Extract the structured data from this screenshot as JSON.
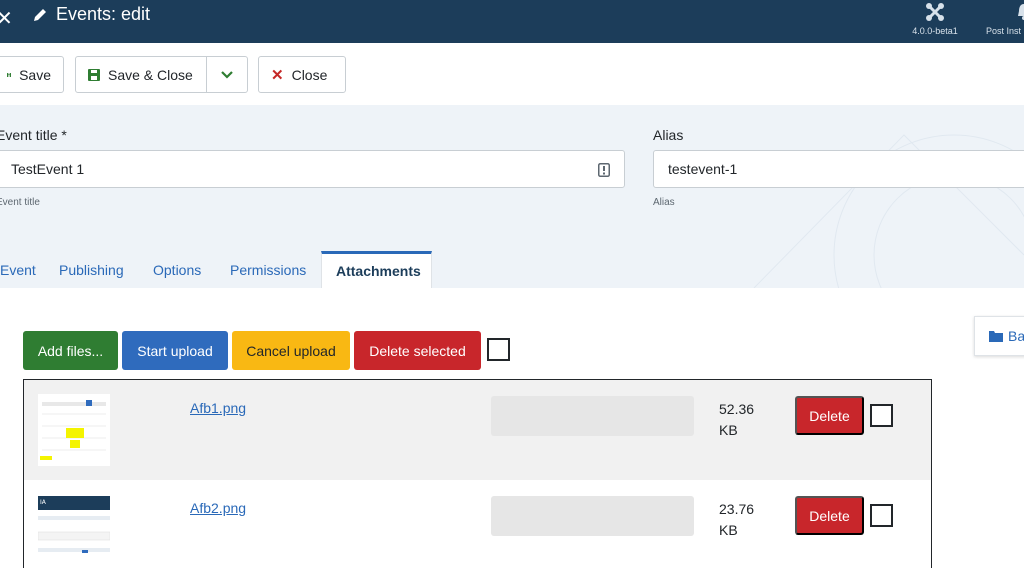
{
  "header": {
    "page_title": "Events: edit",
    "version": "4.0.0-beta1",
    "post_label": "Post Inst"
  },
  "toolbar": {
    "save": "Save",
    "save_close": "Save & Close",
    "close": "Close"
  },
  "form": {
    "title_label": "Event title *",
    "title_value": "TestEvent 1",
    "title_hint": "Event title",
    "alias_label": "Alias",
    "alias_value": "testevent-1",
    "alias_hint": "Alias"
  },
  "tabs": [
    {
      "label": "Event"
    },
    {
      "label": "Publishing"
    },
    {
      "label": "Options"
    },
    {
      "label": "Permissions"
    },
    {
      "label": "Attachments",
      "active": true
    }
  ],
  "upload": {
    "add_files": "Add files...",
    "start_upload": "Start upload",
    "cancel_upload": "Cancel upload",
    "delete_selected": "Delete selected",
    "side_button": "Ba"
  },
  "files": [
    {
      "name": "Afb1.png",
      "size_value": "52.36",
      "size_unit": "KB",
      "delete": "Delete",
      "progress": 0
    },
    {
      "name": "Afb2.png",
      "size_value": "23.76",
      "size_unit": "KB",
      "delete": "Delete",
      "progress": 0
    }
  ],
  "colors": {
    "header_bg": "#1c3d5a",
    "form_bg": "#eef3f8",
    "link": "#2a69b8",
    "success": "#2f7d32",
    "primary": "#2f6bbd",
    "warning": "#f9b813",
    "danger": "#c8262b"
  }
}
